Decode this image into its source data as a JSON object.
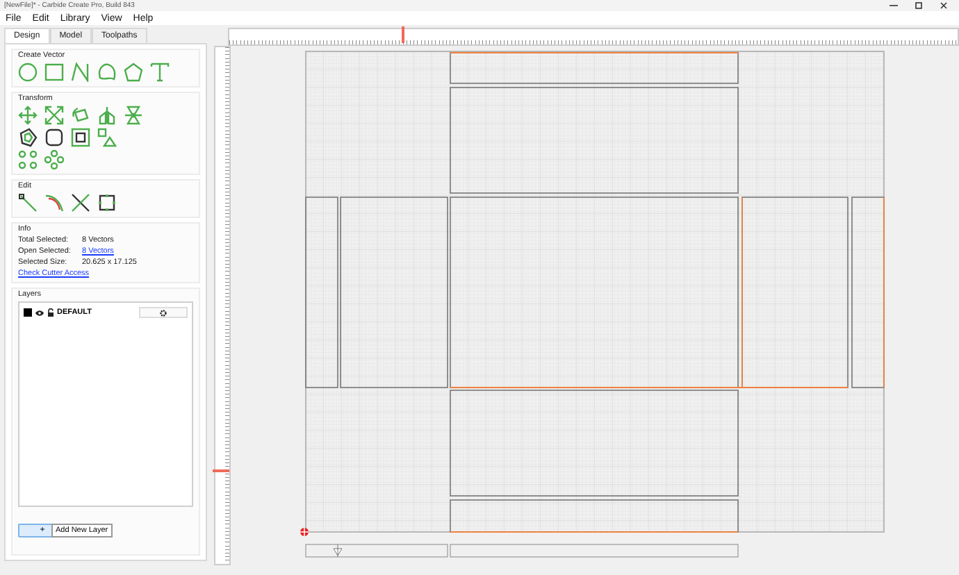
{
  "window": {
    "title": "[NewFile]* - Carbide Create Pro, Build 843"
  },
  "menu": [
    "File",
    "Edit",
    "Library",
    "View",
    "Help"
  ],
  "tabs": [
    {
      "label": "Design",
      "selected": true
    },
    {
      "label": "Model",
      "selected": false
    },
    {
      "label": "Toolpaths",
      "selected": false
    }
  ],
  "sections": [
    {
      "title": "Create Vector",
      "kind": "create"
    },
    {
      "title": "Transform",
      "kind": "transform"
    },
    {
      "title": "Edit",
      "kind": "edit"
    }
  ],
  "info": {
    "title": "Info",
    "rows": [
      {
        "label": "Total Selected:",
        "value": "8 Vectors",
        "kind": "text"
      },
      {
        "label": "Open Selected:",
        "value": "8 Vectors",
        "kind": "link"
      },
      {
        "label": "Selected Size:",
        "value": "20.625 x 17.125",
        "kind": "text"
      }
    ],
    "link": "Check Cutter Access"
  },
  "layers": {
    "title": "Layers",
    "items": [
      {
        "name": "DEFAULT",
        "color": "#000000"
      }
    ],
    "add_button": "+",
    "tooltip": "Add New Layer"
  }
}
